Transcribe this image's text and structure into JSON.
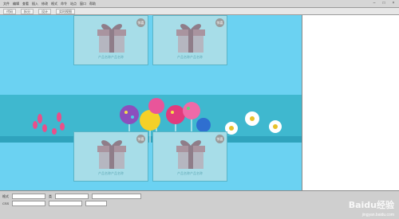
{
  "menu": {
    "items": [
      "文件",
      "编辑",
      "查看",
      "插入",
      "修改",
      "格式",
      "命令",
      "站点",
      "窗口",
      "帮助"
    ]
  },
  "toolbar": {
    "tabs": [
      "代码",
      "拆分",
      "设计",
      "实时视图"
    ]
  },
  "cards": [
    {
      "badge": "惊喜",
      "caption": "产品名称产品名称"
    },
    {
      "badge": "惊喜",
      "caption": "产品名称产品名称"
    },
    {
      "badge": "惊喜",
      "caption": "产品名称产品名称"
    },
    {
      "badge": "惊喜",
      "caption": "产品名称产品名称"
    }
  ],
  "statusbar": {
    "format_label": "格式",
    "class_label": "类",
    "css_label": "CSS"
  },
  "watermark": {
    "logo_text": "Baidu经验",
    "url_text": "jingyan.baidu.com"
  },
  "colors": {
    "canvas_bg": "#6bd2f2",
    "card_bg": "#a7dde8",
    "banner_bg": "#3fb8cf",
    "badge_bg": "#9a9a9a"
  }
}
